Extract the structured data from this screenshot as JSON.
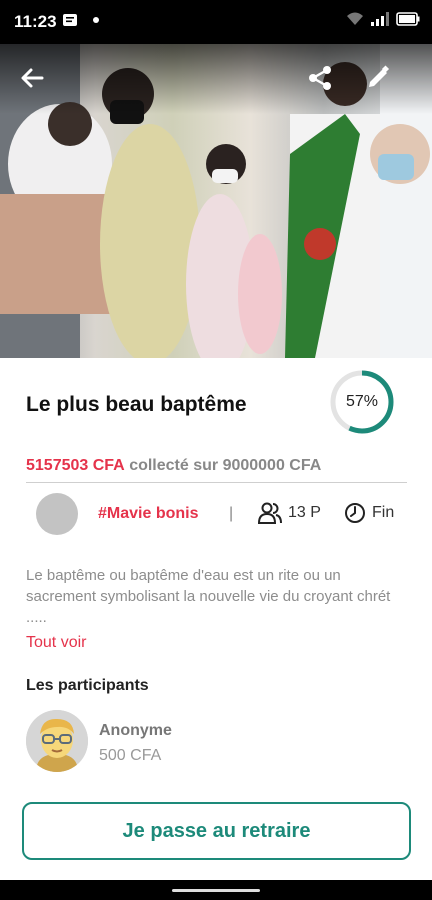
{
  "status_bar": {
    "time": "11:23",
    "icons": [
      "message-icon",
      "dot-icon",
      "wifi-icon",
      "signal-icon",
      "battery-icon"
    ]
  },
  "header": {
    "back_icon": "arrow-left-icon",
    "share_icon": "share-icon",
    "edit_icon": "pencil-icon"
  },
  "campaign": {
    "title": "Le plus beau baptême",
    "progress_percent": 57,
    "progress_label": "57%",
    "collected_amount": "5157503 CFA",
    "collected_text": "collecté sur 9000000 CFA",
    "organizer_name": "#Mavie bonis",
    "separator": "|",
    "participants_count": "13 P",
    "end_label": "Fin",
    "description": "Le baptême ou baptême d'eau est un rite ou un sacrement symbolisant la nouvelle vie du croyant chrét .....",
    "see_all_label": "Tout voir"
  },
  "participants": {
    "heading": "Les participants",
    "items": [
      {
        "name": "Anonyme",
        "amount": "500 CFA"
      }
    ]
  },
  "cta": {
    "label": "Je passe au retraire"
  },
  "colors": {
    "accent_red": "#e5334b",
    "accent_teal": "#1d8a7a",
    "ring_track": "#e3e3e3"
  }
}
